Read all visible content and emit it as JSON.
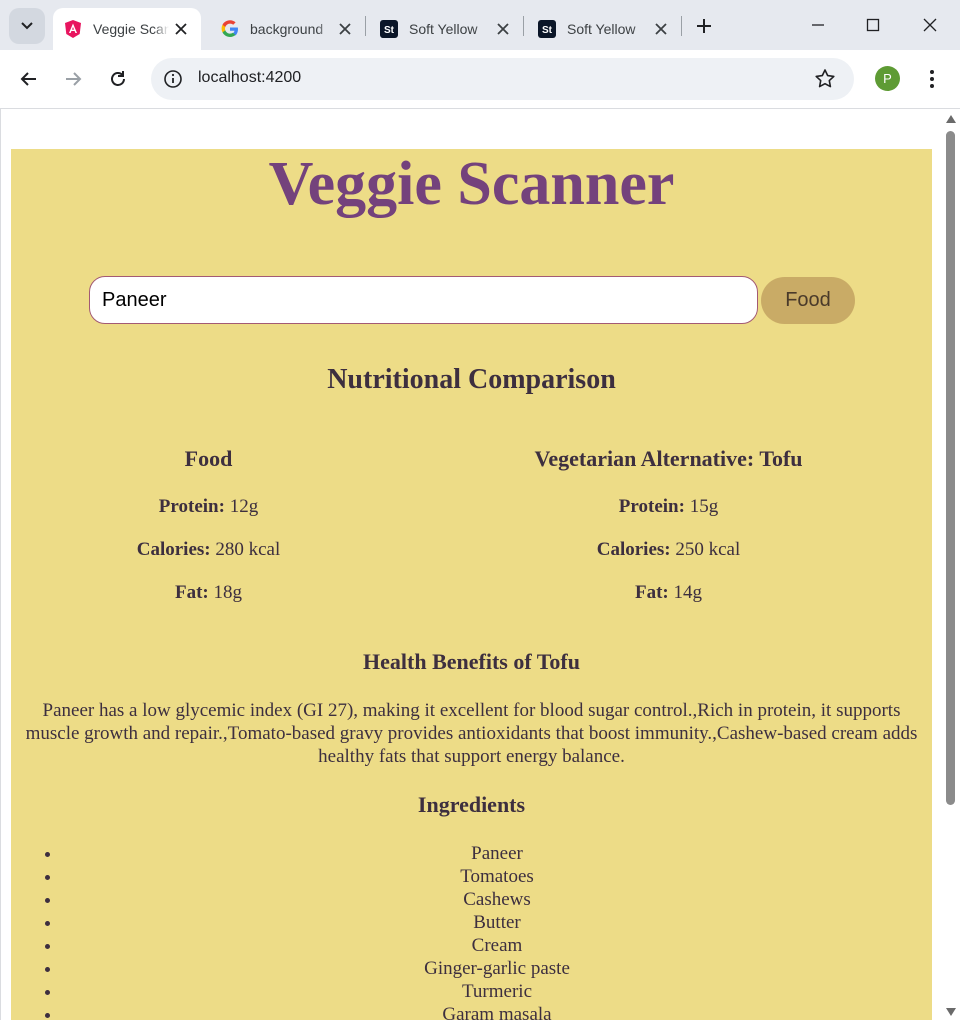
{
  "browser": {
    "tabs": [
      {
        "title": "Veggie Scanner",
        "favicon": "angular-icon",
        "active": true
      },
      {
        "title": "background",
        "favicon": "google-icon",
        "active": false
      },
      {
        "title": "Soft Yellow",
        "favicon": "st-icon",
        "active": false
      },
      {
        "title": "Soft Yellow",
        "favicon": "st-icon",
        "active": false
      }
    ],
    "url": "localhost:4200",
    "profile_initial": "P",
    "st_glyph": "St"
  },
  "app": {
    "title": "Veggie Scanner",
    "search_value": "Paneer",
    "search_button": "Food",
    "comparison_heading": "Nutritional Comparison",
    "food": {
      "heading": "Food",
      "protein_label": "Protein:",
      "protein_value": "12g",
      "calories_label": "Calories:",
      "calories_value": "280 kcal",
      "fat_label": "Fat:",
      "fat_value": "18g"
    },
    "alternative": {
      "heading": "Vegetarian Alternative: Tofu",
      "protein_label": "Protein:",
      "protein_value": "15g",
      "calories_label": "Calories:",
      "calories_value": "250 kcal",
      "fat_label": "Fat:",
      "fat_value": "14g"
    },
    "benefits_heading": "Health Benefits of Tofu",
    "benefits_text": "Paneer has a low glycemic index (GI 27), making it excellent for blood sugar control.,Rich in protein, it supports muscle growth and repair.,Tomato-based gravy provides antioxidants that boost immunity.,Cashew-based cream adds healthy fats that support energy balance.",
    "ingredients_heading": "Ingredients",
    "ingredients": [
      "Paneer",
      "Tomatoes",
      "Cashews",
      "Butter",
      "Cream",
      "Ginger-garlic paste",
      "Turmeric",
      "Garam masala"
    ]
  },
  "colors": {
    "card_bg": "#eddc87",
    "title": "#74427c",
    "button_bg": "#c9ab66",
    "text": "#3d2f3f"
  }
}
